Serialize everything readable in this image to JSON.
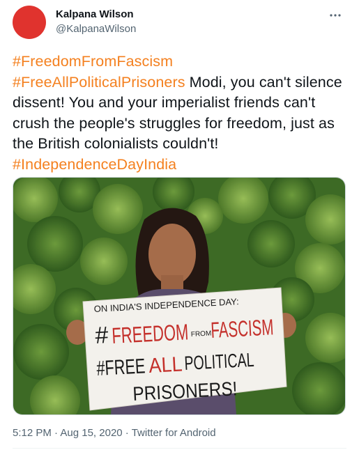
{
  "author": {
    "name": "Kalpana Wilson",
    "handle": "@KalpanaWilson",
    "avatar_color": "#e0332e"
  },
  "tweet": {
    "hashtag1": "#FreedomFromFascism",
    "hashtag2": "#FreeAllPoliticalPrisoners",
    "text_body": " Modi, you can't silence dissent! You and your imperialist friends can't crush the people's struggles for freedom, just as the British colonialists couldn't! ",
    "hashtag3": "#IndependenceDayIndia",
    "hashtag_color": "#f4801f"
  },
  "media": {
    "sign_line1": "ON INDIA'S INDEPENDENCE DAY:",
    "sign_hash1": "#",
    "sign_freedom": "FREEDOM",
    "sign_from": "FROM",
    "sign_fascism": "FASCISM",
    "sign_hash2": "#FREE",
    "sign_all": "ALL",
    "sign_political": "POLITICAL",
    "sign_prisoners": "PRISONERS!"
  },
  "meta": {
    "time": "5:12 PM",
    "dot1": " · ",
    "date": "Aug 15, 2020",
    "dot2": " · ",
    "source": "Twitter for Android"
  },
  "icons": {
    "more": "more-options-icon"
  }
}
